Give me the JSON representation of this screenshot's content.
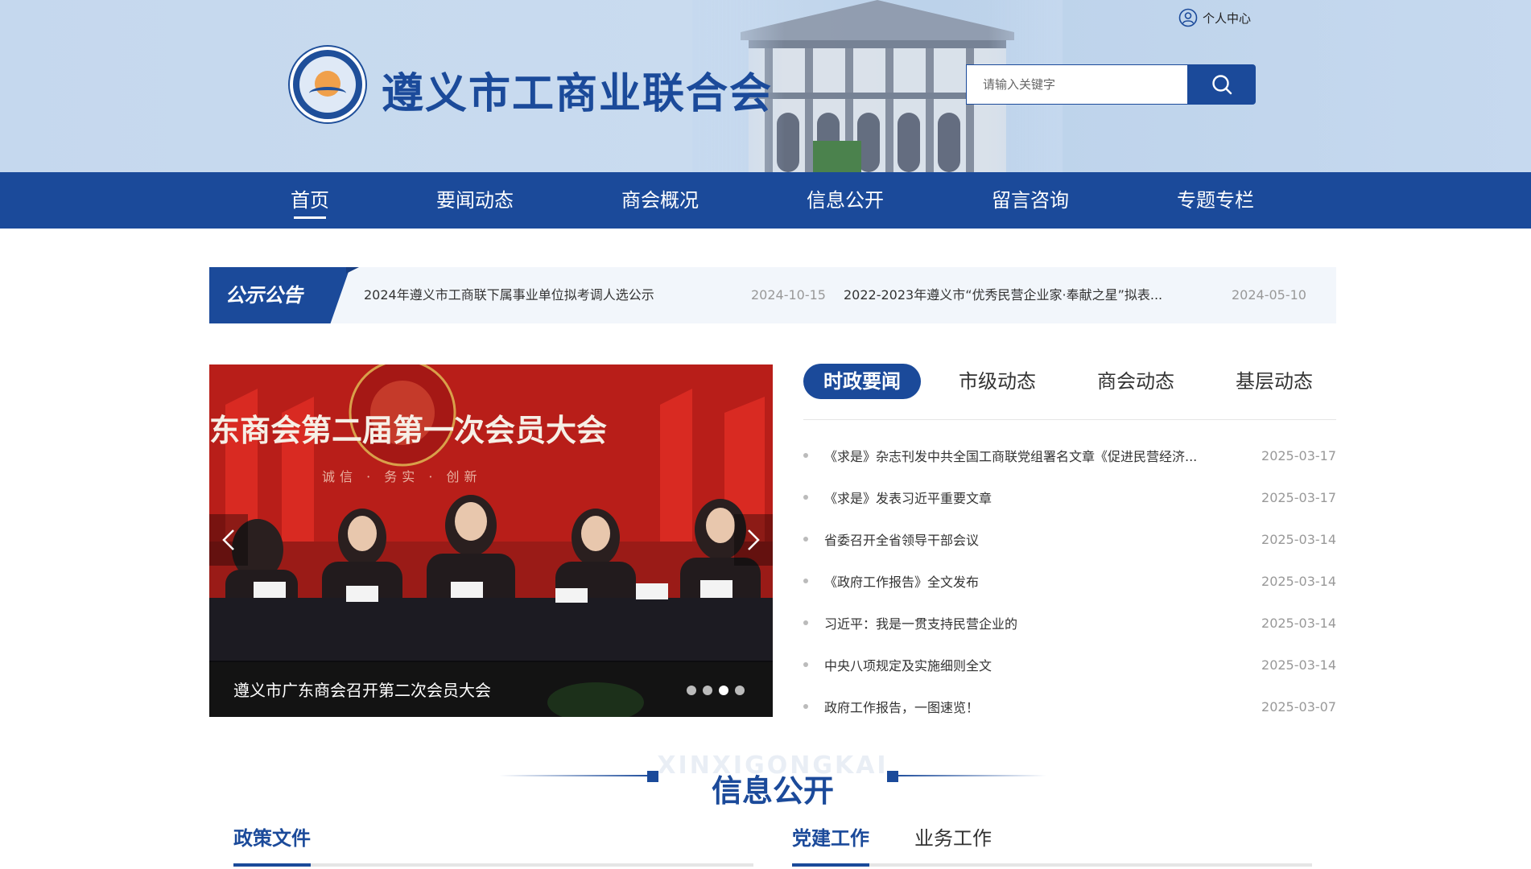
{
  "header": {
    "site_title": "遵义市工商业联合会",
    "user_center": "个人中心",
    "search_placeholder": "请输入关键字"
  },
  "nav": {
    "items": [
      "首页",
      "要闻动态",
      "商会概况",
      "信息公开",
      "留言咨询",
      "专题专栏"
    ],
    "active": 0
  },
  "notice": {
    "tag": "公示公告",
    "items": [
      {
        "title": "2024年遵义市工商联下属事业单位拟考调人选公示",
        "date": "2024-10-15"
      },
      {
        "title": "2022-2023年遵义市“优秀民营企业家·奉献之星”拟表...",
        "date": "2024-05-10"
      }
    ]
  },
  "carousel": {
    "banner_text": "东商会第二届第一次会员大会",
    "caption": "遵义市广东商会召开第二次会员大会",
    "dot_count": 4,
    "active_dot": 2
  },
  "news": {
    "tabs": [
      "时政要闻",
      "市级动态",
      "商会动态",
      "基层动态"
    ],
    "active_tab": 0,
    "items": [
      {
        "title": "《求是》杂志刊发中共全国工商联党组署名文章《促进民营经济...",
        "date": "2025-03-17"
      },
      {
        "title": "《求是》发表习近平重要文章",
        "date": "2025-03-17"
      },
      {
        "title": "省委召开全省领导干部会议",
        "date": "2025-03-14"
      },
      {
        "title": "《政府工作报告》全文发布",
        "date": "2025-03-14"
      },
      {
        "title": "习近平：我是一贯支持民营企业的",
        "date": "2025-03-14"
      },
      {
        "title": "中央八项规定及实施细则全文",
        "date": "2025-03-14"
      },
      {
        "title": "政府工作报告，一图速览！",
        "date": "2025-03-07"
      }
    ]
  },
  "info_section": {
    "bg_text": "XINXIGONGKAI",
    "title": "信息公开",
    "left_tab": "政策文件",
    "right_tabs": [
      "党建工作",
      "业务工作"
    ]
  },
  "colors": {
    "primary": "#1b4a9a",
    "header_bg": "#c6d9ef",
    "banner_red": "#b91c1c"
  }
}
